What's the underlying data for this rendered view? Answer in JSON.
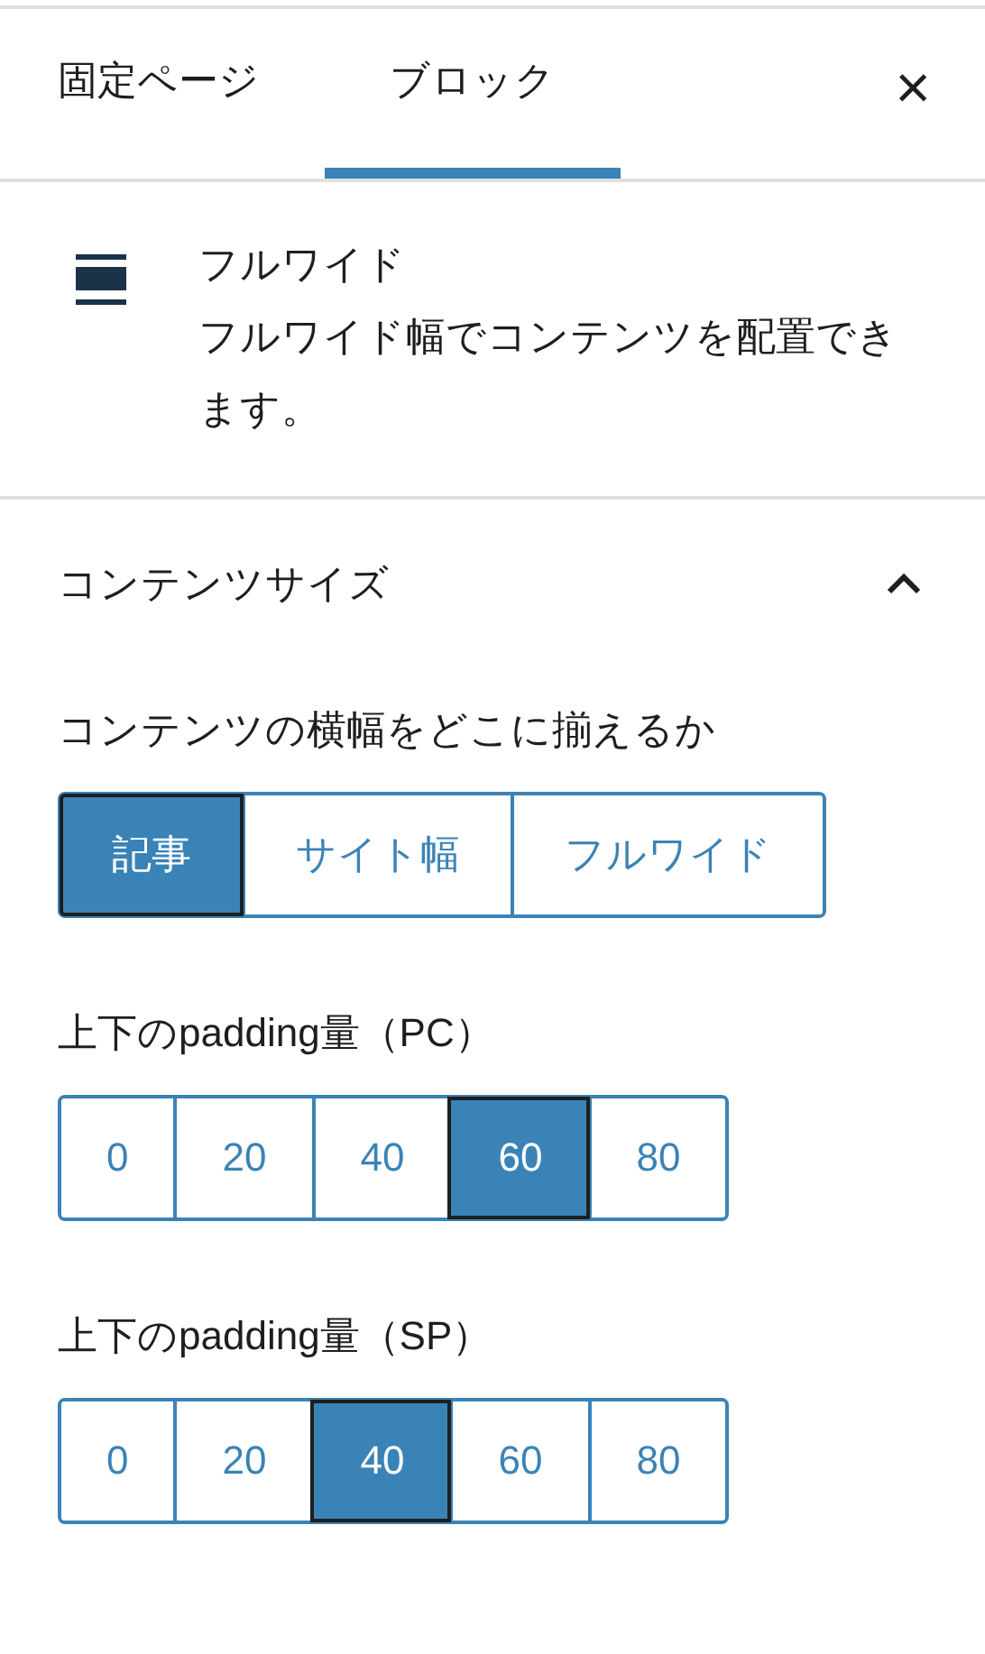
{
  "tabs": [
    {
      "label": "固定ページ",
      "selected": false
    },
    {
      "label": "ブロック",
      "selected": true
    }
  ],
  "close": {
    "label": "×"
  },
  "block": {
    "title": "フルワイド",
    "description": "フルワイド幅でコンテンツを配置できます。"
  },
  "section": {
    "title": "コンテンツサイズ",
    "expanded": true,
    "groups": [
      {
        "label": "コンテンツの横幅をどこに揃えるか",
        "options": [
          {
            "label": "記事",
            "selected": true
          },
          {
            "label": "サイト幅",
            "selected": false
          },
          {
            "label": "フルワイド",
            "selected": false
          }
        ]
      },
      {
        "label": "上下のpadding量（PC）",
        "options": [
          {
            "label": "0",
            "selected": false
          },
          {
            "label": "20",
            "selected": false
          },
          {
            "label": "40",
            "selected": false
          },
          {
            "label": "60",
            "selected": true
          },
          {
            "label": "80",
            "selected": false
          }
        ]
      },
      {
        "label": "上下のpadding量（SP）",
        "options": [
          {
            "label": "0",
            "selected": false
          },
          {
            "label": "20",
            "selected": false
          },
          {
            "label": "40",
            "selected": true
          },
          {
            "label": "60",
            "selected": false
          },
          {
            "label": "80",
            "selected": false
          }
        ]
      }
    ]
  }
}
